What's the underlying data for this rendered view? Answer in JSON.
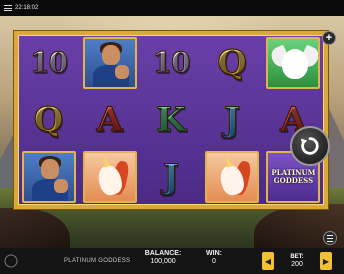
{
  "status_bar": {
    "time": "22:18:02"
  },
  "reels": [
    [
      "10",
      "Q",
      "warrior"
    ],
    [
      "warrior",
      "A",
      "unicorn"
    ],
    [
      "10",
      "K",
      "J"
    ],
    [
      "Q",
      "J",
      "unicorn"
    ],
    [
      "dove",
      "A",
      "logo"
    ]
  ],
  "logo": {
    "line1": "PLATINUM",
    "line2": "GODDESS"
  },
  "icons": {
    "menu": "hamburger-icon",
    "plus": "plus-icon",
    "spin": "spin-arrow-icon",
    "bet_down": "chevron-left-icon",
    "bet_up": "chevron-right-icon"
  },
  "bottom": {
    "game_name": "PLATINUM GODDESS",
    "balance_label": "BALANCE:",
    "balance_value": "100,000",
    "win_label": "WIN:",
    "win_value": "0",
    "bet_label": "BET:",
    "bet_value": "200"
  },
  "colors": {
    "frame": "#d9a93a",
    "reel_bg": "#4a2a86",
    "bet_arrows": "#f0c233"
  }
}
